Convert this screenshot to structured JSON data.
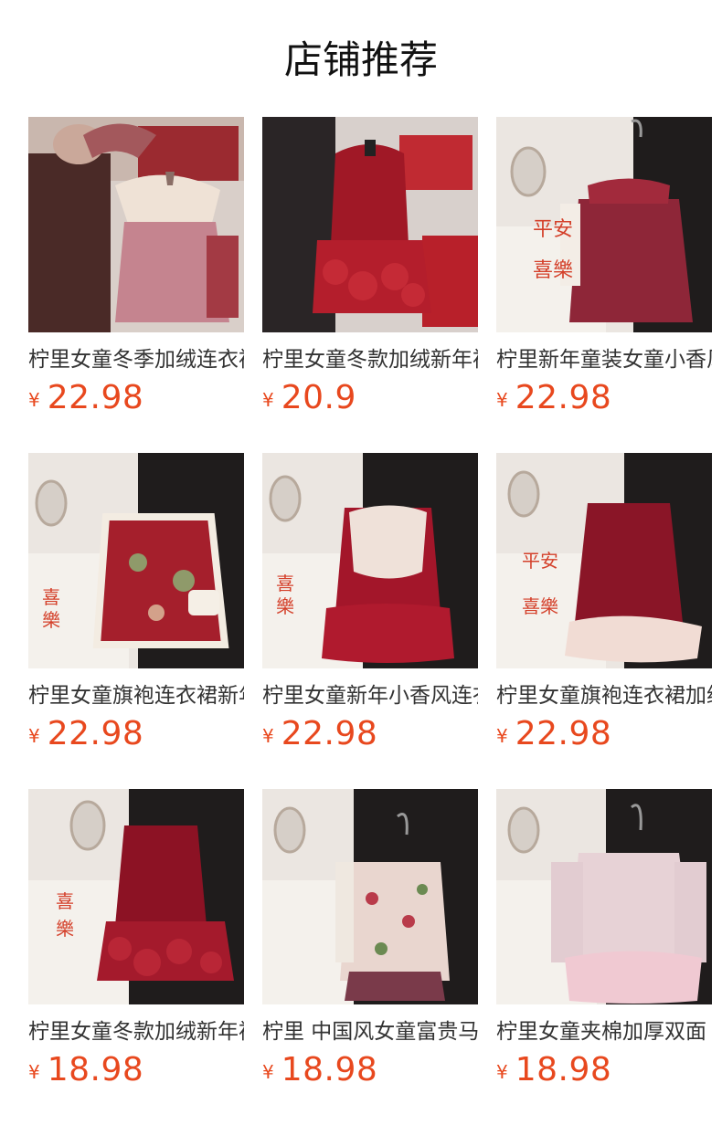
{
  "page": {
    "title": "店铺推荐"
  },
  "currency_symbol": "¥",
  "products": [
    {
      "name": "柠里女童冬季加绒连衣裙",
      "price": "22.98",
      "icon": "pink-cape-dress-photo"
    },
    {
      "name": "柠里女童冬款加绒新年裙",
      "price": "20.9",
      "icon": "red-velvet-qipao-dress-photo"
    },
    {
      "name": "柠里新年童装女童小香风",
      "price": "22.98",
      "icon": "red-tweed-vest-dress-photo"
    },
    {
      "name": "柠里女童旗袍连衣裙新年",
      "price": "22.98",
      "icon": "red-floral-qipao-vest-photo"
    },
    {
      "name": "柠里女童新年小香风连衣",
      "price": "22.98",
      "icon": "red-lace-collar-dress-photo"
    },
    {
      "name": "柠里女童旗袍连衣裙加绒",
      "price": "22.98",
      "icon": "red-sequin-vest-dress-photo"
    },
    {
      "name": "柠里女童冬款加绒新年裙",
      "price": "18.98",
      "icon": "red-velvet-rose-dress-photo"
    },
    {
      "name": "柠里 中国风女童富贵马甲",
      "price": "18.98",
      "icon": "floral-vest-photo"
    },
    {
      "name": "柠里女童夹棉加厚双面",
      "price": "18.98",
      "icon": "pink-quilted-jacket-photo"
    }
  ]
}
